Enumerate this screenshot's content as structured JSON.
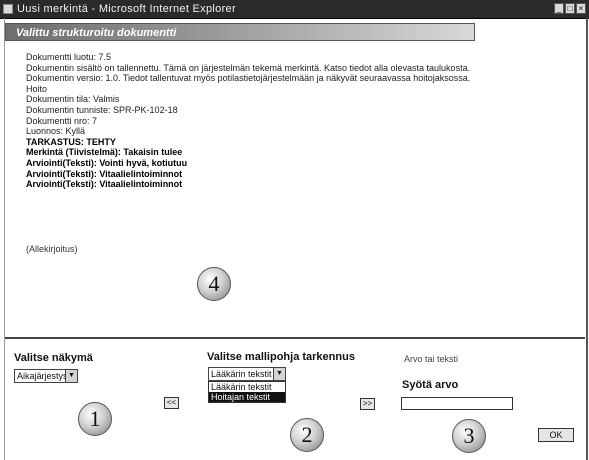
{
  "window": {
    "title": "Uusi merkintä - Microsoft Internet Explorer",
    "minimize": "_",
    "maximize": "□",
    "close": "×"
  },
  "document": {
    "header": "Valittu strukturoitu dokumentti",
    "lines": [
      "Dokumentti luotu: 7.5",
      "Dokumentin sisältö on tallennettu. Tämä on järjestelmän tekemä merkintä. Katso tiedot alla olevasta taulukosta.",
      "Dokumentin versio: 1.0. Tiedot tallentuvat myös potilastietojärjestelmään ja näkyvät seuraavassa hoitojaksossa.",
      "Hoito",
      "Dokumentin tila: Valmis",
      "Dokumentin tunniste: SPR-PK-102-18",
      "Dokumentti nro: 7",
      "Luonnos: Kyllä",
      "TARKASTUS: TEHTY",
      "Merkintä (Tiivistelmä): Takaisin tulee",
      "Arviointi(Teksti): Vointi hyvä, kotiutuu",
      "Arviointi(Teksti): Vitaalielintoiminnot",
      "Arviointi(Teksti): Vitaalielintoiminnot"
    ],
    "bold_from_index": 8,
    "signature": "(Allekirjoitus)"
  },
  "callouts": {
    "one": "1",
    "two": "2",
    "three": "3",
    "four": "4"
  },
  "bottom": {
    "view_label": "Valitse näkymä",
    "view_select_value": "Aikajärjestys",
    "model_label": "Valitse mallipohja tarkennus",
    "model_select_value": "Lääkärin tekstit",
    "dropdown_options": [
      "Lääkärin tekstit",
      "Hoitajan tekstit"
    ],
    "note_label": "Arvo tai teksti",
    "input_label": "Syötä arvo",
    "arrow_left": "<<",
    "arrow_right": ">>",
    "ok_label": "OK"
  }
}
